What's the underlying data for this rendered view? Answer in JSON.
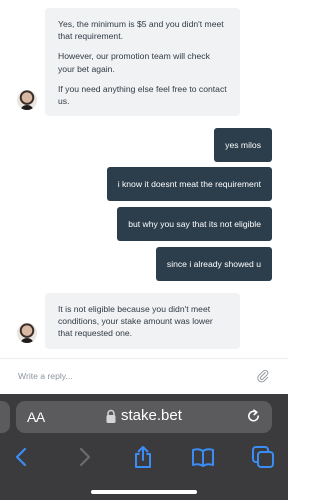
{
  "messages": [
    {
      "from": "agent",
      "paragraphs": [
        "Yes, the minimum is $5 and you didn't meet that requirement.",
        "However, our promotion team will check your bet again.",
        "If you need anything else feel free to contact us."
      ]
    },
    {
      "from": "user",
      "text": "yes milos"
    },
    {
      "from": "user",
      "text": "i know it doesnt meat the requirement"
    },
    {
      "from": "user",
      "text": "but why you say that its not eligible"
    },
    {
      "from": "user",
      "text": "since i already showed u"
    },
    {
      "from": "agent",
      "paragraphs": [
        "It is not eligible because you didn't meet conditions, your stake amount was lower that requested one."
      ]
    }
  ],
  "composer": {
    "placeholder": "Write a reply..."
  },
  "browser": {
    "text_size_label": "AA",
    "url": "stake.bet"
  }
}
